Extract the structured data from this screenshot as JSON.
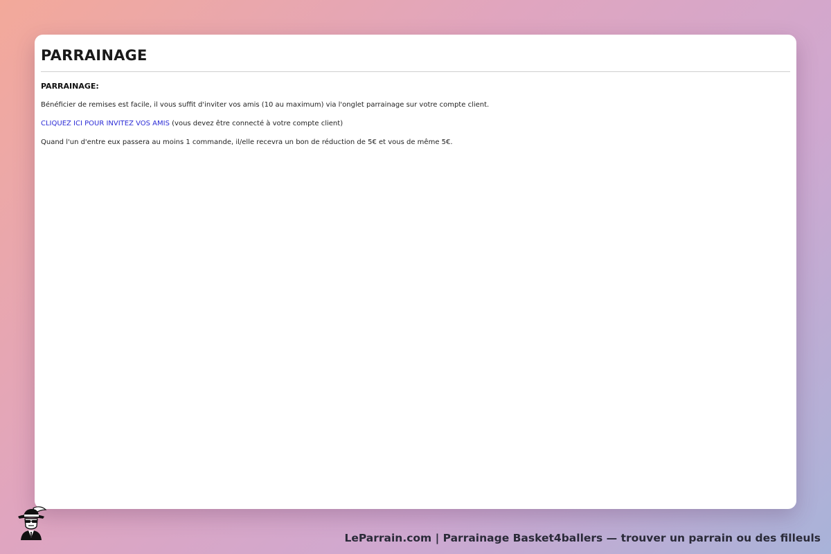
{
  "page": {
    "title": "PARRAINAGE"
  },
  "content": {
    "section_heading": "PARRAINAGE:",
    "intro": "Bénéficier de remises est facile, il vous suffit d'inviter vos amis (10 au maximum) via l'onglet parrainage sur votre compte client.",
    "invite_link_label": "CLIQUEZ ICI POUR INVITEZ VOS AMIS",
    "invite_note": " (vous devez être connecté à votre compte client)",
    "reward_text": "Quand l'un d'entre eux passera au moins 1 commande, il/elle recevra un bon de réduction de 5€ et vous de même 5€."
  },
  "footer": {
    "logo_icon": "mafia-godfather-logo-icon",
    "caption": "LeParrain.com | Parrainage Basket4ballers — trouver un parrain ou des filleuls"
  },
  "colors": {
    "link": "#2b2bd6",
    "card_background": "#ffffff",
    "title_text": "#1a1a1a"
  }
}
